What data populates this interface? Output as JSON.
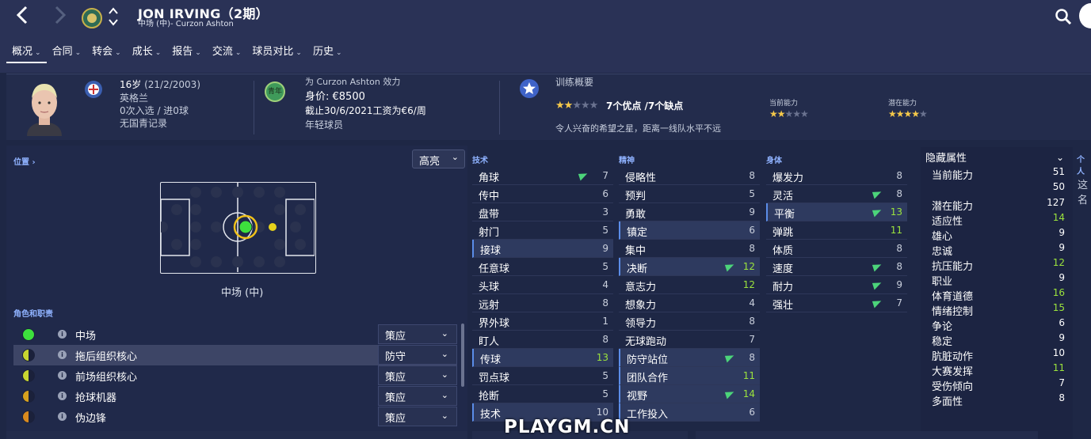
{
  "header": {
    "player_name": "JON IRVING（2期）",
    "subtitle": "中场 (中)- Curzon Ashton",
    "back_icon": "back-chevron-icon",
    "forward_icon": "forward-chevron-icon"
  },
  "tabs": [
    {
      "label": "概况"
    },
    {
      "label": "合同"
    },
    {
      "label": "转会"
    },
    {
      "label": "成长"
    },
    {
      "label": "报告"
    },
    {
      "label": "交流"
    },
    {
      "label": "球员对比"
    },
    {
      "label": "历史"
    }
  ],
  "summary": {
    "age": "16岁",
    "dob": "(21/2/2003)",
    "nation": "英格兰",
    "caps": "0次入选 / 进0球",
    "youth_record": "无国青记录",
    "youth_badge": "青年",
    "plays_for": "为 Curzon Ashton 效力",
    "value": "身价: €8500",
    "contract": "截止30/6/2021工资为€6/周",
    "contract_type": "年轻球员",
    "training_title": "训练概要",
    "strengths": "7个优点 /7个缺点",
    "training_stars": 2,
    "description": "令人兴奋的希望之星，距离一线队水平不远",
    "current_ability_label": "当前能力",
    "current_ability_stars": 2,
    "potential_ability_label": "潜在能力",
    "potential_ability_stars": 4
  },
  "position": {
    "title": "位置",
    "highlight_label": "高亮",
    "position_label": "中场 (中)"
  },
  "roles": {
    "title": "角色和职责",
    "items": [
      {
        "name": "中场",
        "duty": "策应",
        "color": "#3de03d"
      },
      {
        "name": "拖后组织核心",
        "duty": "防守",
        "color": "#c8d630"
      },
      {
        "name": "前场组织核心",
        "duty": "策应",
        "color": "#c8d630"
      },
      {
        "name": "抢球机器",
        "duty": "策应",
        "color": "#d7a11e"
      },
      {
        "name": "伪边锋",
        "duty": "策应",
        "color": "#d98a1e"
      }
    ]
  },
  "technical": {
    "title": "技术",
    "items": [
      {
        "name": "角球",
        "value": "7",
        "arrow": true,
        "hl": false,
        "green": false
      },
      {
        "name": "传中",
        "value": "6",
        "arrow": false,
        "hl": false,
        "green": false
      },
      {
        "name": "盘带",
        "value": "3",
        "arrow": false,
        "hl": false,
        "green": false
      },
      {
        "name": "射门",
        "value": "5",
        "arrow": false,
        "hl": false,
        "green": false
      },
      {
        "name": "接球",
        "value": "9",
        "arrow": false,
        "hl": true,
        "green": false
      },
      {
        "name": "任意球",
        "value": "5",
        "arrow": false,
        "hl": false,
        "green": false
      },
      {
        "name": "头球",
        "value": "4",
        "arrow": false,
        "hl": false,
        "green": false
      },
      {
        "name": "远射",
        "value": "8",
        "arrow": false,
        "hl": false,
        "green": false
      },
      {
        "name": "界外球",
        "value": "1",
        "arrow": false,
        "hl": false,
        "green": false
      },
      {
        "name": "盯人",
        "value": "8",
        "arrow": false,
        "hl": false,
        "green": false
      },
      {
        "name": "传球",
        "value": "13",
        "arrow": false,
        "hl": true,
        "green": true
      },
      {
        "name": "罚点球",
        "value": "5",
        "arrow": false,
        "hl": false,
        "green": false
      },
      {
        "name": "抢断",
        "value": "5",
        "arrow": false,
        "hl": false,
        "green": false
      },
      {
        "name": "技术",
        "value": "10",
        "arrow": false,
        "hl": true,
        "green": false
      }
    ]
  },
  "mental": {
    "title": "精神",
    "items": [
      {
        "name": "侵略性",
        "value": "8",
        "arrow": false,
        "hl": false,
        "green": false
      },
      {
        "name": "预判",
        "value": "5",
        "arrow": false,
        "hl": false,
        "green": false
      },
      {
        "name": "勇敢",
        "value": "9",
        "arrow": false,
        "hl": false,
        "green": false
      },
      {
        "name": "镇定",
        "value": "6",
        "arrow": false,
        "hl": true,
        "green": false
      },
      {
        "name": "集中",
        "value": "8",
        "arrow": false,
        "hl": false,
        "green": false
      },
      {
        "name": "决断",
        "value": "12",
        "arrow": true,
        "hl": true,
        "green": true
      },
      {
        "name": "意志力",
        "value": "12",
        "arrow": false,
        "hl": false,
        "green": true
      },
      {
        "name": "想象力",
        "value": "4",
        "arrow": false,
        "hl": false,
        "green": false
      },
      {
        "name": "领导力",
        "value": "8",
        "arrow": false,
        "hl": false,
        "green": false
      },
      {
        "name": "无球跑动",
        "value": "7",
        "arrow": false,
        "hl": false,
        "green": false
      },
      {
        "name": "防守站位",
        "value": "8",
        "arrow": true,
        "hl": true,
        "green": false
      },
      {
        "name": "团队合作",
        "value": "11",
        "arrow": false,
        "hl": true,
        "green": true
      },
      {
        "name": "视野",
        "value": "14",
        "arrow": true,
        "hl": true,
        "green": true
      },
      {
        "name": "工作投入",
        "value": "6",
        "arrow": false,
        "hl": true,
        "green": false
      }
    ]
  },
  "physical": {
    "title": "身体",
    "items": [
      {
        "name": "爆发力",
        "value": "8",
        "arrow": false,
        "hl": false,
        "green": false
      },
      {
        "name": "灵活",
        "value": "8",
        "arrow": true,
        "hl": false,
        "green": false
      },
      {
        "name": "平衡",
        "value": "13",
        "arrow": true,
        "hl": true,
        "green": true
      },
      {
        "name": "弹跳",
        "value": "11",
        "arrow": false,
        "hl": false,
        "green": true
      },
      {
        "name": "体质",
        "value": "8",
        "arrow": false,
        "hl": false,
        "green": false
      },
      {
        "name": "速度",
        "value": "8",
        "arrow": true,
        "hl": false,
        "green": false
      },
      {
        "name": "耐力",
        "value": "9",
        "arrow": true,
        "hl": false,
        "green": false
      },
      {
        "name": "强壮",
        "value": "7",
        "arrow": true,
        "hl": false,
        "green": false
      }
    ]
  },
  "hidden": {
    "title": "隐藏属性",
    "personal_tab": "个人",
    "personal_text": "这名",
    "items": [
      {
        "name": "当前能力",
        "value": "51",
        "green": false
      },
      {
        "name": "",
        "value": "50",
        "green": false
      },
      {
        "name": "潜在能力",
        "value": "127",
        "green": false
      },
      {
        "name": "适应性",
        "value": "14",
        "green": true
      },
      {
        "name": "雄心",
        "value": "9",
        "green": false
      },
      {
        "name": "忠诚",
        "value": "9",
        "green": false
      },
      {
        "name": "抗压能力",
        "value": "12",
        "green": true
      },
      {
        "name": "职业",
        "value": "9",
        "green": false
      },
      {
        "name": "体育道德",
        "value": "16",
        "green": true
      },
      {
        "name": "情绪控制",
        "value": "15",
        "green": true
      },
      {
        "name": "争论",
        "value": "6",
        "green": false
      },
      {
        "name": "稳定",
        "value": "9",
        "green": false
      },
      {
        "name": "肮脏动作",
        "value": "10",
        "green": false
      },
      {
        "name": "大赛发挥",
        "value": "11",
        "green": true
      },
      {
        "name": "受伤倾向",
        "value": "7",
        "green": false
      },
      {
        "name": "多面性",
        "value": "8",
        "green": false
      }
    ]
  },
  "watermark": "PLAYGM.CN"
}
